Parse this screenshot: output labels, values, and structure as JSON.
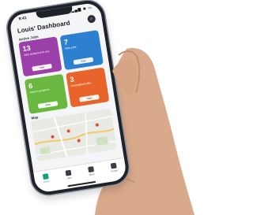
{
  "status": {
    "time": "9:41",
    "icons": "▂▄▆ ◉ ▭"
  },
  "header": {
    "title": "Louis' Dashboard",
    "search_icon": "search-icon"
  },
  "section": {
    "label": "Active Jobs"
  },
  "tiles": [
    {
      "value": "13",
      "label": "Jobs assigned to you",
      "button": "View",
      "color": "#9b3fa9"
    },
    {
      "value": "7",
      "label": "New jobs",
      "button": "View",
      "color": "#2d7fd0"
    },
    {
      "value": "6",
      "label": "Jobs in progress",
      "button": "View",
      "color": "#6bb840"
    },
    {
      "value": "3",
      "label": "Unassigned jobs",
      "button": "View",
      "color": "#e8642a"
    }
  ],
  "map": {
    "label": "Map"
  },
  "tabbar": {
    "items": [
      {
        "label": "Home",
        "icon": "home-icon",
        "active": true
      },
      {
        "label": "Jobs",
        "icon": "jobs-icon",
        "active": false
      },
      {
        "label": "Plans",
        "icon": "book-icon",
        "active": false
      },
      {
        "label": "People",
        "icon": "people-icon",
        "active": false
      }
    ]
  }
}
